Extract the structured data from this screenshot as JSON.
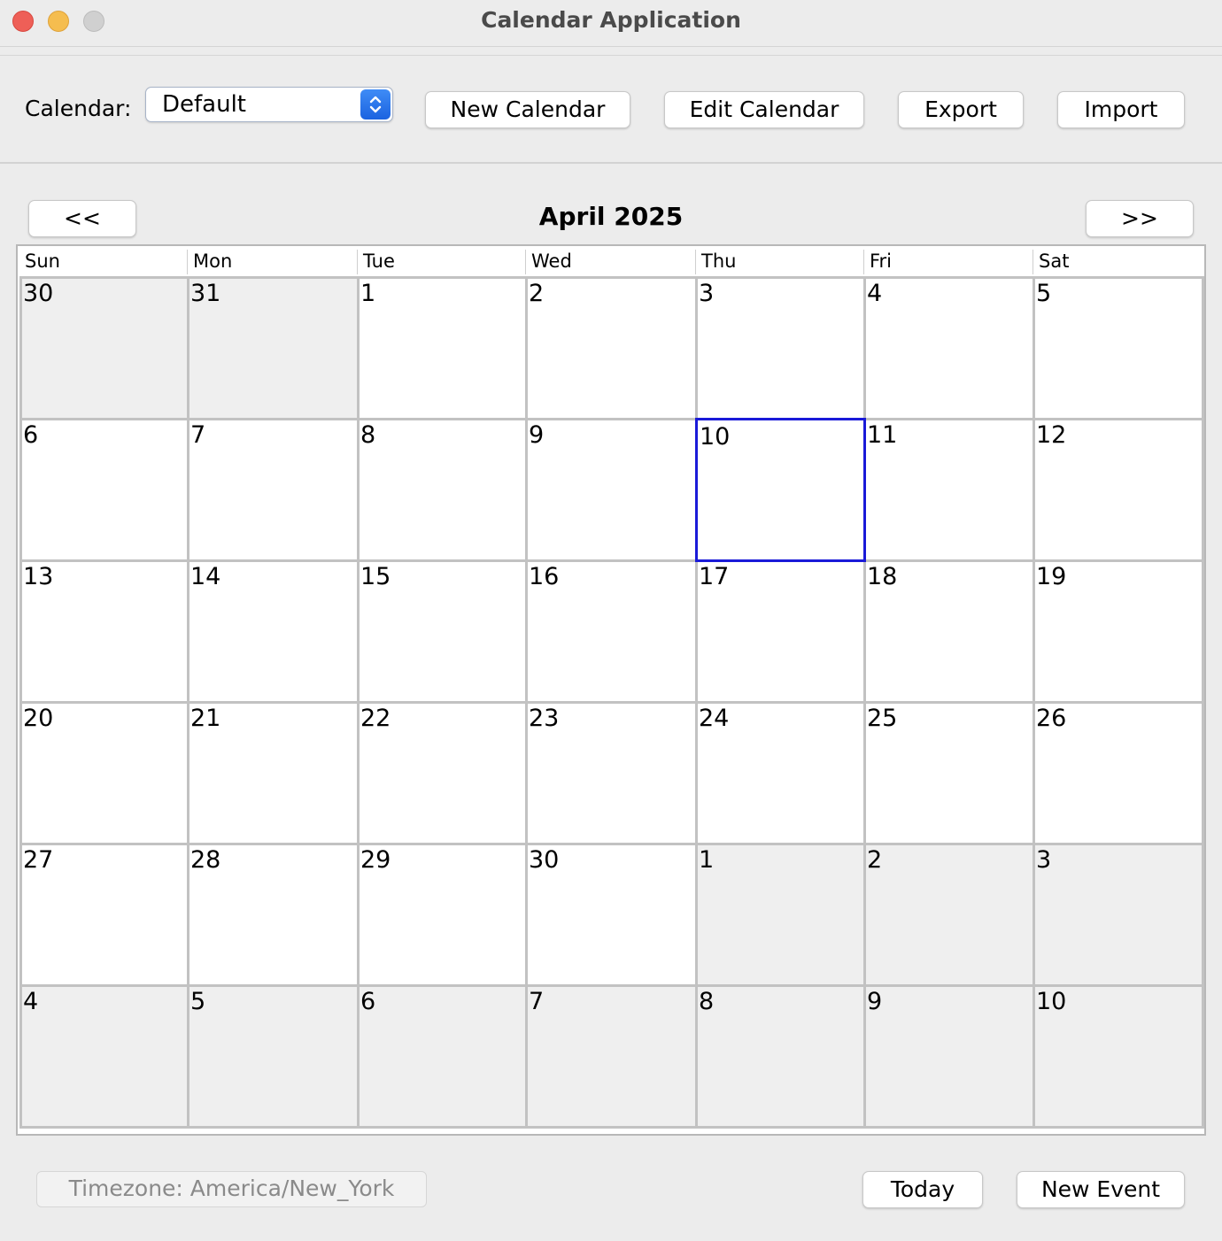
{
  "window": {
    "title": "Calendar Application"
  },
  "toolbar": {
    "calendar_label": "Calendar:",
    "calendar_select_value": "Default",
    "new_calendar": "New Calendar",
    "edit_calendar": "Edit Calendar",
    "export": "Export",
    "import": "Import"
  },
  "nav": {
    "prev": "<<",
    "next": ">>",
    "month_title": "April 2025"
  },
  "weekdays": [
    "Sun",
    "Mon",
    "Tue",
    "Wed",
    "Thu",
    "Fri",
    "Sat"
  ],
  "weeks": [
    [
      {
        "d": "30",
        "other": true
      },
      {
        "d": "31",
        "other": true
      },
      {
        "d": "1"
      },
      {
        "d": "2"
      },
      {
        "d": "3"
      },
      {
        "d": "4"
      },
      {
        "d": "5"
      }
    ],
    [
      {
        "d": "6"
      },
      {
        "d": "7"
      },
      {
        "d": "8"
      },
      {
        "d": "9"
      },
      {
        "d": "10",
        "today": true
      },
      {
        "d": "11"
      },
      {
        "d": "12"
      }
    ],
    [
      {
        "d": "13"
      },
      {
        "d": "14"
      },
      {
        "d": "15"
      },
      {
        "d": "16"
      },
      {
        "d": "17"
      },
      {
        "d": "18"
      },
      {
        "d": "19"
      }
    ],
    [
      {
        "d": "20"
      },
      {
        "d": "21"
      },
      {
        "d": "22"
      },
      {
        "d": "23"
      },
      {
        "d": "24"
      },
      {
        "d": "25"
      },
      {
        "d": "26"
      }
    ],
    [
      {
        "d": "27"
      },
      {
        "d": "28"
      },
      {
        "d": "29"
      },
      {
        "d": "30"
      },
      {
        "d": "1",
        "other": true
      },
      {
        "d": "2",
        "other": true
      },
      {
        "d": "3",
        "other": true
      }
    ],
    [
      {
        "d": "4",
        "other": true
      },
      {
        "d": "5",
        "other": true
      },
      {
        "d": "6",
        "other": true
      },
      {
        "d": "7",
        "other": true
      },
      {
        "d": "8",
        "other": true
      },
      {
        "d": "9",
        "other": true
      },
      {
        "d": "10",
        "other": true
      }
    ]
  ],
  "footer": {
    "timezone": "Timezone: America/New_York",
    "today": "Today",
    "new_event": "New Event"
  },
  "colors": {
    "today_border": "#1a1ad8",
    "other_month_bg": "#efefef",
    "select_accent": "#2a74ea"
  }
}
